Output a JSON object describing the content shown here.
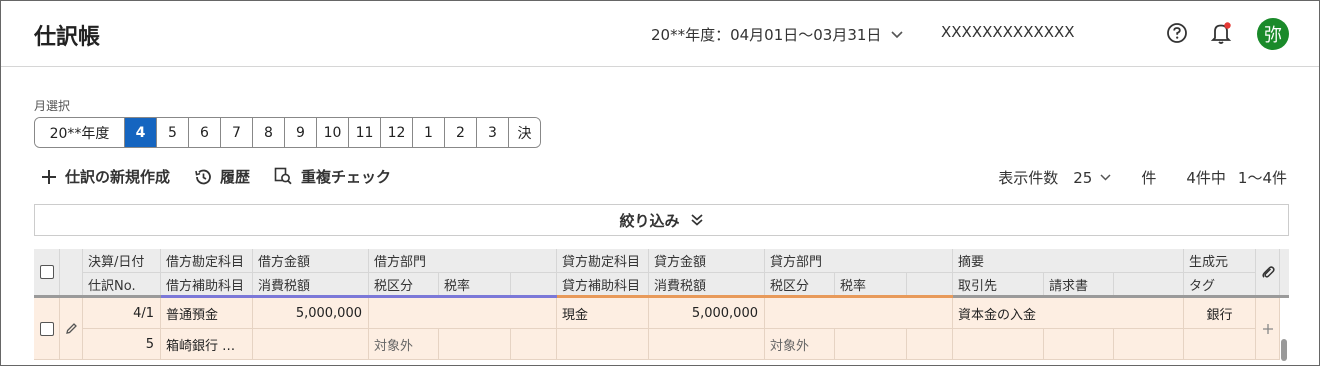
{
  "header": {
    "title": "仕訳帳",
    "period": "20**年度：04月01日〜03月31日",
    "company": "XXXXXXXXXXXXX",
    "avatar": "弥"
  },
  "month_selector": {
    "label": "月選択",
    "items": [
      "20**年度",
      "4",
      "5",
      "6",
      "7",
      "8",
      "9",
      "10",
      "11",
      "12",
      "1",
      "2",
      "3",
      "決"
    ],
    "active": "4"
  },
  "toolbar": {
    "new_entry": "仕訳の新規作成",
    "history": "履歴",
    "duplicate_check": "重複チェック"
  },
  "pagination": {
    "per_page_label": "表示件数",
    "per_page": "25",
    "unit": "件",
    "total": "4件中",
    "range": "1〜4件"
  },
  "filter": {
    "label": "絞り込み"
  },
  "table": {
    "headers": {
      "date": "決算/日付",
      "slip_no": "仕訳No.",
      "debit_account": "借方勘定科目",
      "debit_sub": "借方補助科目",
      "debit_amount": "借方金額",
      "debit_tax": "消費税額",
      "debit_dept": "借方部門",
      "debit_tax_class": "税区分",
      "debit_tax_rate": "税率",
      "credit_account": "貸方勘定科目",
      "credit_sub": "貸方補助科目",
      "credit_amount": "貸方金額",
      "credit_tax": "消費税額",
      "credit_dept": "貸方部門",
      "credit_tax_class": "税区分",
      "credit_tax_rate": "税率",
      "summary": "摘要",
      "partner": "取引先",
      "invoice": "請求書",
      "source": "生成元",
      "tag": "タグ"
    },
    "rows": [
      {
        "date": "4/1",
        "slip_no": "5",
        "debit_account": "普通預金",
        "debit_sub": "箱崎銀行 …",
        "debit_amount": "5,000,000",
        "debit_tax_class": "対象外",
        "credit_account": "現金",
        "credit_amount": "5,000,000",
        "credit_tax_class": "対象外",
        "summary": "資本金の入金",
        "source": "銀行"
      }
    ]
  },
  "colors": {
    "accent": "#1565c0",
    "debit_bar": "#7b78d8",
    "credit_bar": "#e89a5a",
    "row_bg": "#fdeee2",
    "avatar": "#1a8a2a",
    "notification_dot": "#e53935"
  }
}
